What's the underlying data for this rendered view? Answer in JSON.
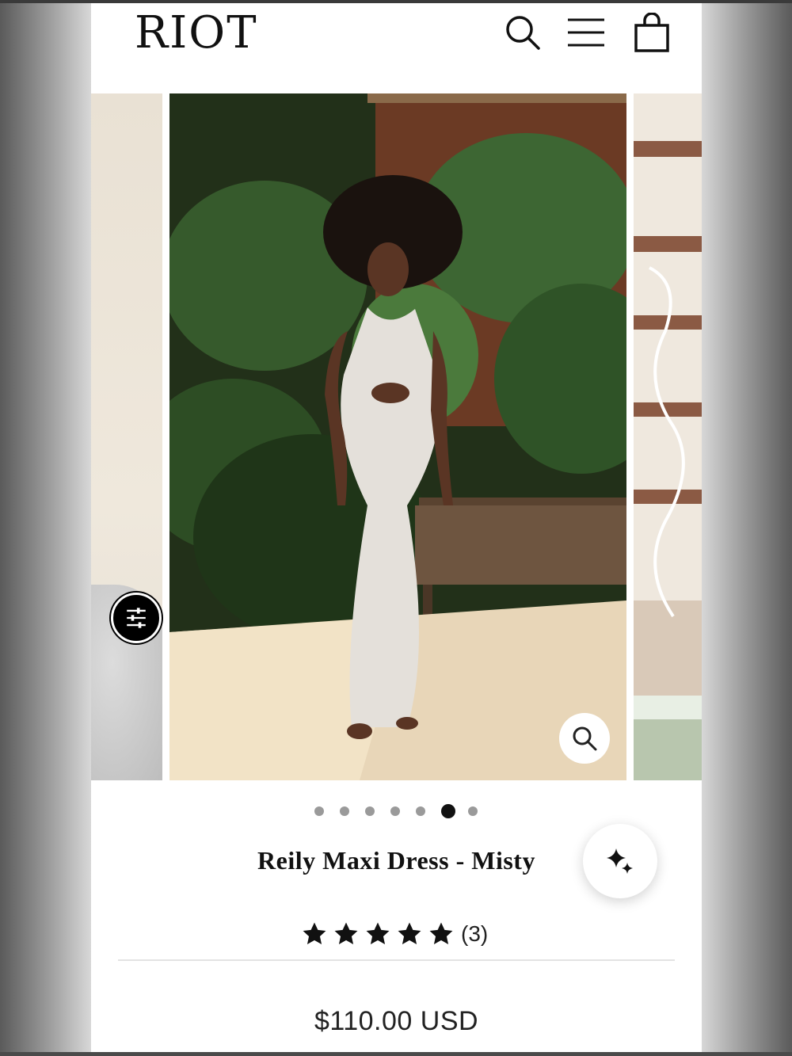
{
  "header": {
    "logo": "RIOT",
    "icons": [
      "search-icon",
      "menu-icon",
      "cart-icon"
    ]
  },
  "gallery": {
    "slide_count": 7,
    "active_slide": 6,
    "filter_icon": "sliders-icon",
    "zoom_icon": "zoom-icon"
  },
  "product": {
    "title": "Reily Maxi Dress - Misty",
    "rating_stars": 5,
    "rating_count": "(3)",
    "price": "$110.00 USD"
  },
  "ai_button": {
    "icon": "sparkle-icon"
  },
  "colors": {
    "text": "#111111",
    "dot_inactive": "#9a9a9a",
    "dot_active": "#111111",
    "divider": "#e3e3e3"
  }
}
